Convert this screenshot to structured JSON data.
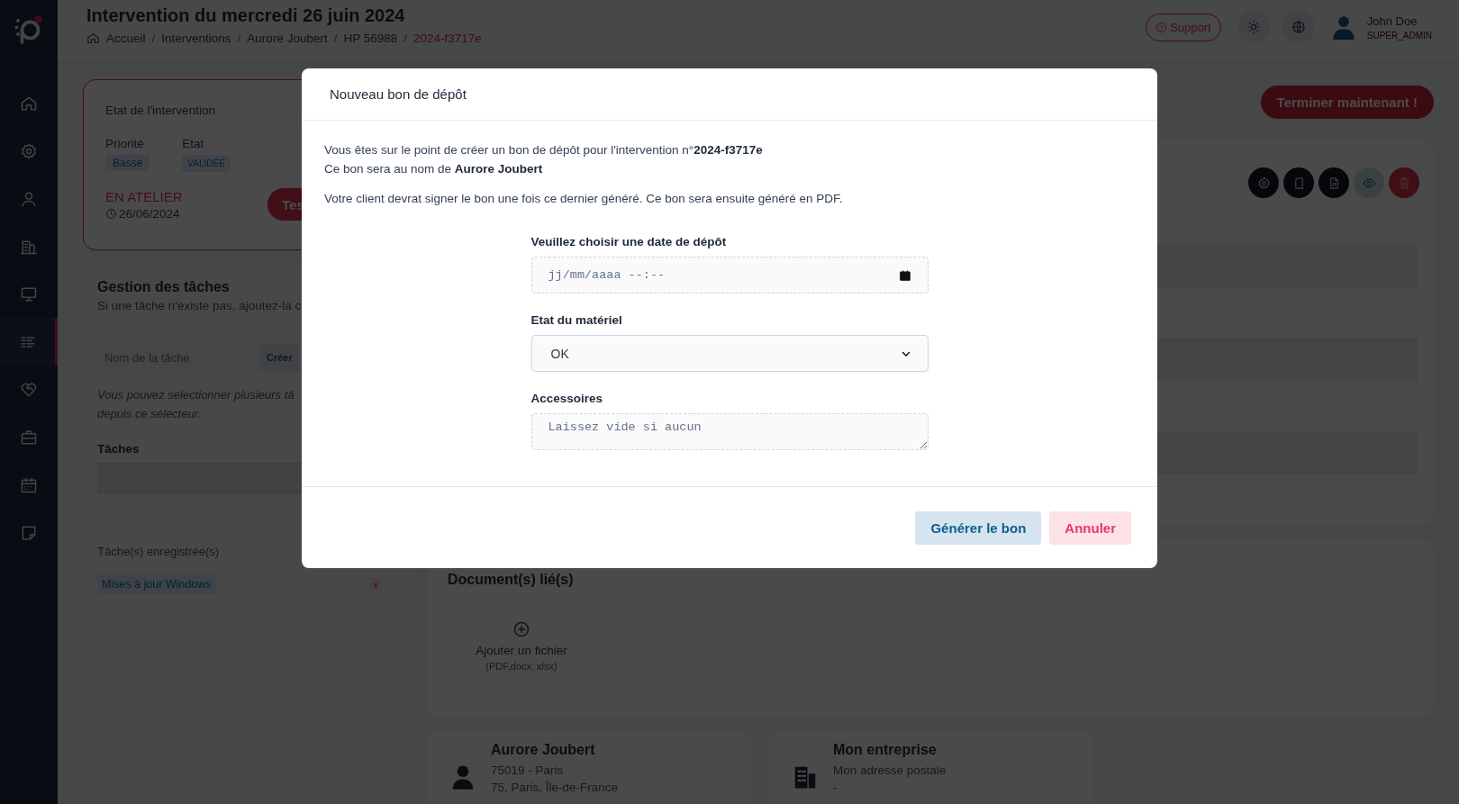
{
  "header": {
    "title": "Intervention du mercredi 26 juin 2024",
    "breadcrumb": [
      {
        "label": "Accueil",
        "current": false
      },
      {
        "label": "Interventions",
        "current": false
      },
      {
        "label": "Aurore Joubert",
        "current": false
      },
      {
        "label": "HP 56988",
        "current": false
      },
      {
        "label": "2024-f3717e",
        "current": true
      }
    ],
    "breadcrumb_separator": "/",
    "support_button": "Support",
    "user": {
      "name": "John Doe",
      "role": "SUPER_ADMIN"
    }
  },
  "sidebar": {
    "items": [
      {
        "selected": false
      },
      {
        "selected": false
      },
      {
        "selected": false
      },
      {
        "selected": false
      },
      {
        "selected": false
      },
      {
        "selected": true
      },
      {
        "selected": false
      },
      {
        "selected": false
      },
      {
        "selected": false
      },
      {
        "selected": false
      }
    ]
  },
  "intervention_state": {
    "title": "Etat de l'intervention",
    "priority": {
      "label": "Priorité",
      "value": "Basse"
    },
    "status": {
      "label": "Etat",
      "value": "VALIDÉE"
    },
    "location": "EN ATELIER",
    "date": "26/06/2024",
    "button": "Tes"
  },
  "task_management": {
    "title": "Gestion des tâches",
    "subtitle": "Si une tâche n'existe pas, ajoutez-la c",
    "task_name_placeholder": "Nom de la tâche",
    "create_button": "Créer",
    "hint_lines": [
      "Vous pouvez selectionner plusieurs tâ",
      "depuis ce sélecteur."
    ],
    "tasks_label": "Tâches",
    "saved_label": "Tâche(s) enregistrée(s)",
    "saved_tasks": [
      {
        "name": "Mises à jour Windows",
        "remove": "x"
      }
    ]
  },
  "finish_button": "Terminer maintenant !",
  "documents": {
    "title": "Document(s) lié(s)",
    "upload_label": "Ajouter un fichier",
    "upload_formats": "(PDF,docx, xlsx)"
  },
  "contacts": [
    {
      "kind": "person",
      "name": "Aurore Joubert",
      "lines": [
        "75019 - Paris",
        "75, Paris, Île-de-France"
      ]
    },
    {
      "kind": "company",
      "name": "Mon entreprise",
      "lines": [
        "Mon adresse postale",
        "-"
      ]
    }
  ],
  "modal": {
    "title": "Nouveau bon de dépôt",
    "paragraphs": [
      "Vous êtes sur le point de créer un bon de dépôt pour l'intervention n°**2024-f3717e**\nCe bon sera au nom de **Aurore Joubert**",
      "Votre client devrat signer le bon une fois ce dernier généré. Ce bon sera ensuite généré en PDF."
    ],
    "fields": [
      {
        "kind": "date",
        "label": "Veuillez choisir une date de dépôt",
        "placeholder": "jj/mm/aaaa --:--"
      },
      {
        "kind": "select",
        "label": "Etat du matériel",
        "value": "OK"
      },
      {
        "kind": "textarea",
        "label": "Accessoires",
        "placeholder": "Laissez vide si aucun"
      }
    ],
    "buttons": [
      {
        "kind": "primary",
        "label": "Générer le bon"
      },
      {
        "kind": "cancel",
        "label": "Annuler"
      }
    ]
  }
}
